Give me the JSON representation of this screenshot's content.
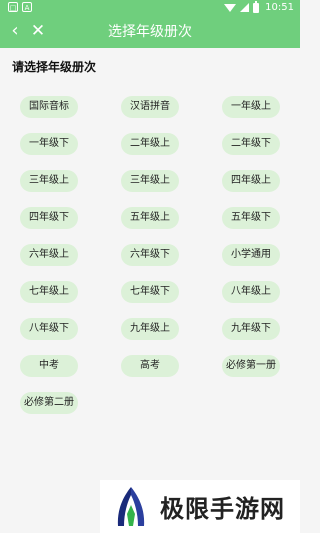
{
  "statusbar": {
    "time": "10:51",
    "left_icons": [
      "square-notification-icon",
      "a-notification-icon"
    ],
    "left_glyphs": [
      "□",
      "A"
    ]
  },
  "appbar": {
    "title": "选择年级册次",
    "back_glyph": "‹",
    "close_glyph": "✕"
  },
  "prompt": "请选择年级册次",
  "grades": [
    "国际音标",
    "汉语拼音",
    "一年级上",
    "一年级下",
    "二年级上",
    "二年级下",
    "三年级上",
    "三年级上",
    "四年级上",
    "四年级下",
    "五年级上",
    "五年级下",
    "六年级上",
    "六年级下",
    "小学通用",
    "七年级上",
    "七年级下",
    "八年级上",
    "八年级下",
    "九年级上",
    "九年级下",
    "中考",
    "高考",
    "必修第一册",
    "必修第二册"
  ],
  "watermark": {
    "text": "极限手游网"
  },
  "colors": {
    "primary": "#6fcf7d",
    "chip": "#dcf1d8",
    "background": "#f5f5f5"
  }
}
